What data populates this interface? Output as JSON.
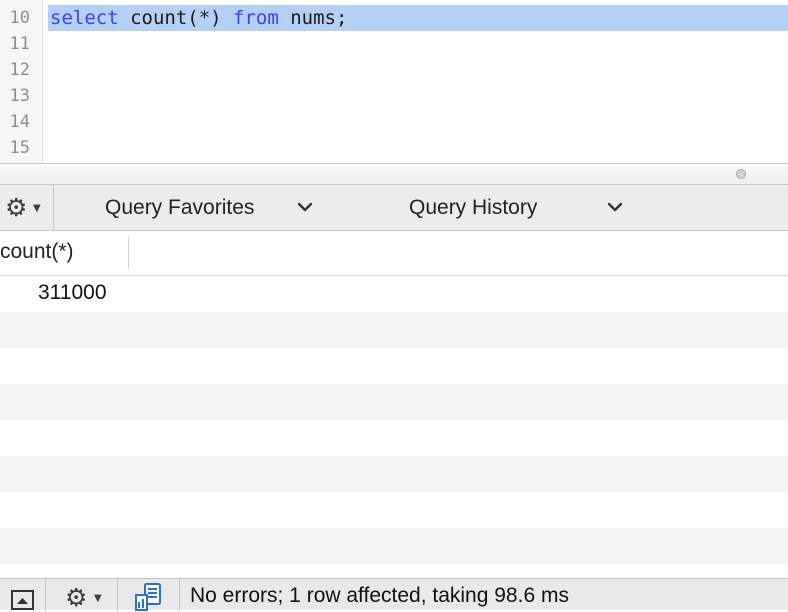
{
  "editor": {
    "lines": [
      {
        "num": "10",
        "selected": true
      },
      {
        "num": "11"
      },
      {
        "num": "12"
      },
      {
        "num": "13"
      },
      {
        "num": "14"
      },
      {
        "num": "15"
      }
    ],
    "query": {
      "kw_select": "select",
      "mid": " count(*) ",
      "kw_from": "from",
      "tail": " nums;"
    },
    "keyword_color": "#3d3df5",
    "selection_color": "#b5d0f5"
  },
  "toolbar": {
    "gear_icon": "gear-icon",
    "favorites_label": "Query Favorites",
    "history_label": "Query History"
  },
  "results": {
    "columns": [
      "count(*)"
    ],
    "rows": [
      [
        "311000"
      ]
    ]
  },
  "status": {
    "message": "No errors; 1 row affected, taking 98.6 ms"
  }
}
